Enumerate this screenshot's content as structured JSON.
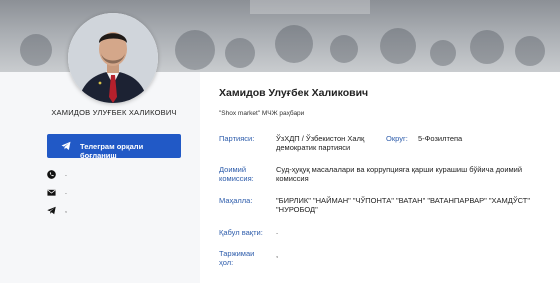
{
  "profile": {
    "name_upper": "ХАМИДОВ УЛУҒБЕК ХАЛИКОВИЧ",
    "full_name": "Хамидов Улуғбек Халикович",
    "position": "\"Shox market\" МЧЖ раҳбари"
  },
  "contact": {
    "telegram_button": "Телеграм орқали боғланиш",
    "phone": ".",
    "email": ".",
    "telegram": ","
  },
  "info": {
    "party_label": "Партияси:",
    "party_value": "ЎзХДП / Ўзбекистон Халқ демократик партияси",
    "district_label": "Округ:",
    "district_value": "5-Фозилтепа",
    "commission_label": "Доимий комиссия:",
    "commission_value": "Суд-ҳуқуқ масалалари ва коррупцияга қарши курашиш бўйича доимий комиссия",
    "mahalla_label": "Маҳалла:",
    "mahalla_value": "\"БИРЛИК\" \"НАЙМАН\" \"ЧЎПОНТА\" \"ВАТАН\" \"ВАТАНПАРВАР\" \"ХАМДЎСТ\" \"НУРОБОД\"",
    "reception_label": "Қабул вақти:",
    "reception_value": ".",
    "bio_label": "Таржимаи ҳол:",
    "bio_value": ","
  },
  "icons": {
    "phone": "phone-icon",
    "email": "envelope-icon",
    "telegram": "telegram-icon"
  },
  "colors": {
    "accent": "#2159c6",
    "label": "#2d5cab"
  }
}
